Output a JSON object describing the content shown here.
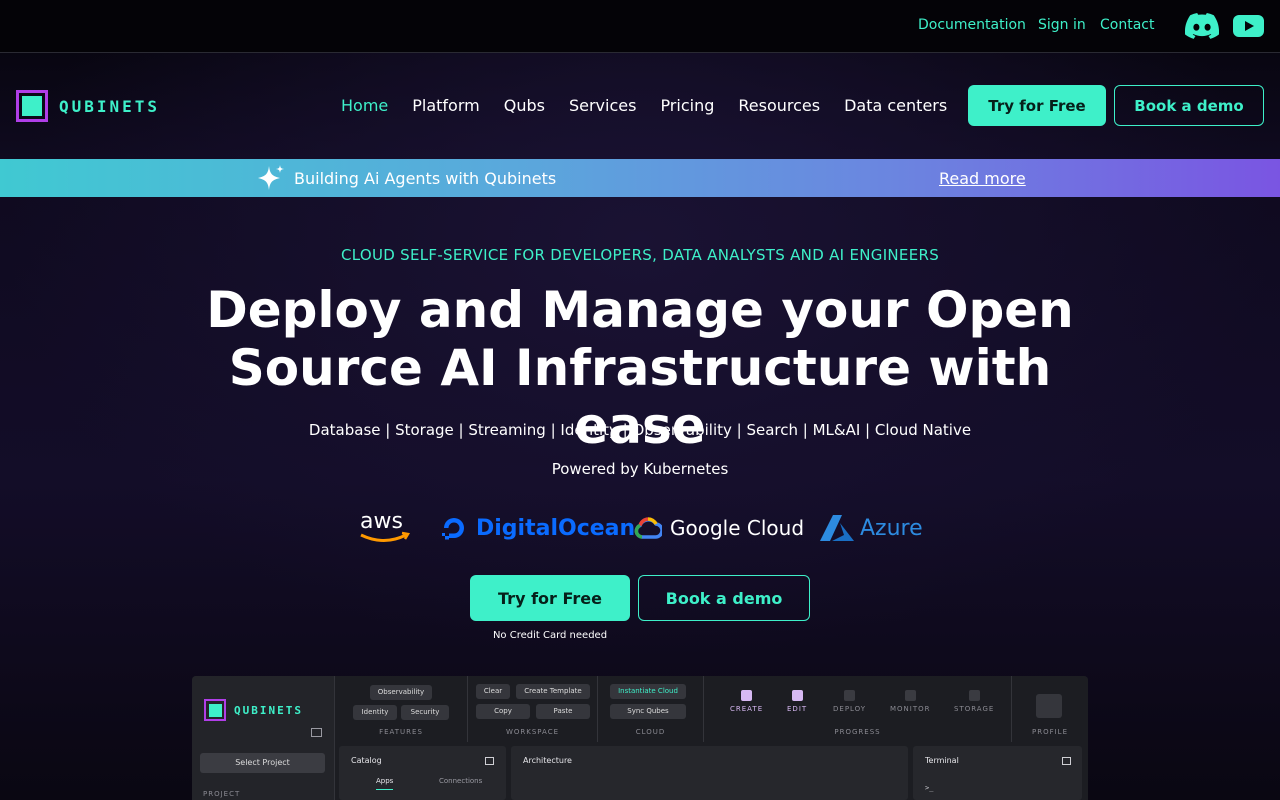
{
  "topbar": {
    "links": [
      "Documentation",
      "Sign in",
      "Contact"
    ],
    "icons": [
      "discord-icon",
      "youtube-icon"
    ]
  },
  "brand": {
    "name": "QUBINETS",
    "colors": {
      "accent": "#3ef0c9",
      "logo_border": "#b03ee8"
    }
  },
  "nav": {
    "items": [
      "Home",
      "Platform",
      "Qubs",
      "Services",
      "Pricing",
      "Resources",
      "Data centers"
    ],
    "active": "Home",
    "try_label": "Try for Free",
    "demo_label": "Book a demo"
  },
  "banner": {
    "icon": "sparkle-icon",
    "text": "Building Ai Agents with Qubinets",
    "link": "Read more"
  },
  "hero": {
    "eyebrow": "CLOUD SELF-SERVICE FOR DEVELOPERS, DATA ANALYSTS AND AI ENGINEERS",
    "headline": "Deploy and Manage your Open Source AI Infrastructure with ease",
    "tagline": "Database | Storage | Streaming | Identity | Observability | Search | ML&AI | Cloud Native",
    "powered": "Powered by Kubernetes",
    "providers": [
      "aws",
      "DigitalOcean",
      "Google Cloud",
      "Azure"
    ],
    "try_label": "Try for Free",
    "demo_label": "Book a demo",
    "note": "No Credit Card needed"
  },
  "preview": {
    "logo": "QUBINETS",
    "select_project": "Select Project",
    "project_label": "PROJECT",
    "features": {
      "chips": [
        "Observability",
        "Identity",
        "Security"
      ],
      "label": "FEATURES"
    },
    "workspace": {
      "chips": [
        "Clear",
        "Create Template",
        "Copy",
        "Paste"
      ],
      "label": "WORKSPACE"
    },
    "cloud": {
      "chips": [
        "Instantiate Cloud",
        "Sync Qubes"
      ],
      "label": "CLOUD"
    },
    "progress": {
      "steps": [
        "CREATE",
        "EDIT",
        "DEPLOY",
        "MONITOR",
        "STORAGE"
      ],
      "label": "PROGRESS"
    },
    "profile_label": "PROFILE",
    "catalog": {
      "title": "Catalog",
      "tabs": [
        "Apps",
        "Connections"
      ]
    },
    "architecture_title": "Architecture",
    "terminal": {
      "title": "Terminal",
      "prompt": ">_"
    }
  }
}
